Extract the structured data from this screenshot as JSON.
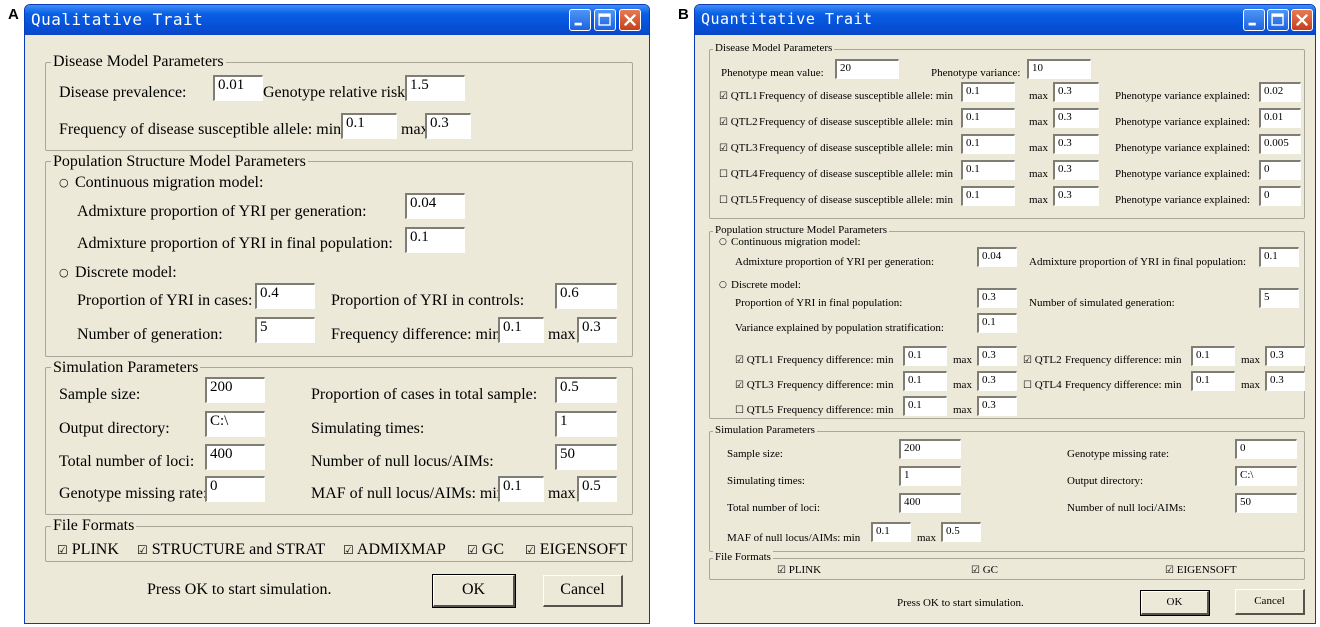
{
  "panel_a": {
    "letter": "A",
    "title": "Qualitative Trait",
    "disease": {
      "legend": "Disease Model Parameters",
      "prevalence_label": "Disease prevalence:",
      "prevalence_value": "0.01",
      "grr_label": "Genotype relative risk:",
      "grr_value": "1.5",
      "freq_label": "Frequency of disease susceptible allele:  min",
      "freq_min": "0.1",
      "max_label": "max",
      "freq_max": "0.3"
    },
    "population": {
      "legend": "Population Structure Model Parameters",
      "continuous_label": "Continuous migration model:",
      "adm_gen_label": "Admixture proportion of YRI per generation:",
      "adm_gen_value": "0.04",
      "adm_final_label": "Admixture proportion of YRI in final population:",
      "adm_final_value": "0.1",
      "discrete_label": "Discrete model:",
      "cases_label": "Proportion of YRI in cases:",
      "cases_value": "0.4",
      "controls_label": "Proportion of YRI in controls:",
      "controls_value": "0.6",
      "ngen_label": "Number of generation:",
      "ngen_value": "5",
      "fd_label": "Frequency difference:  min",
      "fd_min": "0.1",
      "max_label": "max",
      "fd_max": "0.3"
    },
    "simulation": {
      "legend": "Simulation Parameters",
      "sample_label": "Sample size:",
      "sample_value": "200",
      "prop_cases_label": "Proportion of cases in total sample:",
      "prop_cases_value": "0.5",
      "outdir_label": "Output directory:",
      "outdir_value": "C:\\",
      "times_label": "Simulating times:",
      "times_value": "1",
      "loci_label": "Total number of loci:",
      "loci_value": "400",
      "null_label": "Number of null locus/AIMs:",
      "null_value": "50",
      "missing_label": "Genotype missing rate:",
      "missing_value": "0",
      "maf_label": "MAF of null locus/AIMs:  min",
      "maf_min": "0.1",
      "max_label": "max",
      "maf_max": "0.5"
    },
    "formats": {
      "legend": "File Formats",
      "items": [
        "PLINK",
        "STRUCTURE and STRAT",
        "ADMIXMAP",
        "GC",
        "EIGENSOFT"
      ]
    },
    "footer": {
      "hint": "Press OK to start simulation.",
      "ok": "OK",
      "cancel": "Cancel"
    }
  },
  "panel_b": {
    "letter": "B",
    "title": "Quantitative Trait",
    "disease": {
      "legend": "Disease Model Parameters",
      "mean_label": "Phenotype mean value:",
      "mean_value": "20",
      "var_label": "Phenotype variance:",
      "var_value": "10",
      "freq_label": "Frequency of disease susceptible allele:  min",
      "max_label": "max",
      "pve_label": "Phenotype variance explained:",
      "qtls": [
        {
          "name": "QTL1",
          "checked": true,
          "min": "0.1",
          "max": "0.3",
          "pve": "0.02"
        },
        {
          "name": "QTL2",
          "checked": true,
          "min": "0.1",
          "max": "0.3",
          "pve": "0.01"
        },
        {
          "name": "QTL3",
          "checked": true,
          "min": "0.1",
          "max": "0.3",
          "pve": "0.005"
        },
        {
          "name": "QTL4",
          "checked": false,
          "min": "0.1",
          "max": "0.3",
          "pve": "0"
        },
        {
          "name": "QTL5",
          "checked": false,
          "min": "0.1",
          "max": "0.3",
          "pve": "0"
        }
      ]
    },
    "population": {
      "legend": "Population structure Model Parameters",
      "continuous_label": "Continuous migration model:",
      "adm_gen_label": "Admixture proportion of YRI per generation:",
      "adm_gen_value": "0.04",
      "adm_final_label": "Admixture proportion of YRI in final population:",
      "adm_final_value": "0.1",
      "discrete_label": "Discrete model:",
      "prop_final_label": "Proportion of YRI in final population:",
      "prop_final_value": "0.3",
      "nsim_label": "Number of simulated generation:",
      "nsim_value": "5",
      "strat_label": "Variance explained by population stratification:",
      "strat_value": "0.1",
      "fd_label": "Frequency difference:  min",
      "max_label": "max",
      "qtl_fd": [
        {
          "name": "QTL1",
          "checked": true,
          "min": "0.1",
          "max": "0.3"
        },
        {
          "name": "QTL2",
          "checked": true,
          "min": "0.1",
          "max": "0.3"
        },
        {
          "name": "QTL3",
          "checked": true,
          "min": "0.1",
          "max": "0.3"
        },
        {
          "name": "QTL4",
          "checked": false,
          "min": "0.1",
          "max": "0.3"
        },
        {
          "name": "QTL5",
          "checked": false,
          "min": "0.1",
          "max": "0.3"
        }
      ]
    },
    "simulation": {
      "legend": "Simulation Parameters",
      "sample_label": "Sample size:",
      "sample_value": "200",
      "missing_label": "Genotype missing rate:",
      "missing_value": "0",
      "times_label": "Simulating times:",
      "times_value": "1",
      "outdir_label": "Output directory:",
      "outdir_value": "C:\\",
      "loci_label": "Total number of loci:",
      "loci_value": "400",
      "null_label": "Number of null loci/AIMs:",
      "null_value": "50",
      "maf_label": "MAF of null locus/AIMs:  min",
      "maf_min": "0.1",
      "max_label": "max",
      "maf_max": "0.5"
    },
    "formats": {
      "legend": "File Formats",
      "items": [
        "PLINK",
        "GC",
        "EIGENSOFT"
      ]
    },
    "footer": {
      "hint": "Press OK to start simulation.",
      "ok": "OK",
      "cancel": "Cancel"
    }
  },
  "icons": {
    "check_on": "☑",
    "check_off": "☐",
    "radio": "○",
    "minimize_icon": "minimize-icon",
    "maximize_icon": "maximize-icon",
    "close_icon": "close-icon"
  },
  "colors": {
    "titlebar": "#0a5fe4",
    "window_face": "#ece9d8",
    "close": "#c5401c"
  }
}
